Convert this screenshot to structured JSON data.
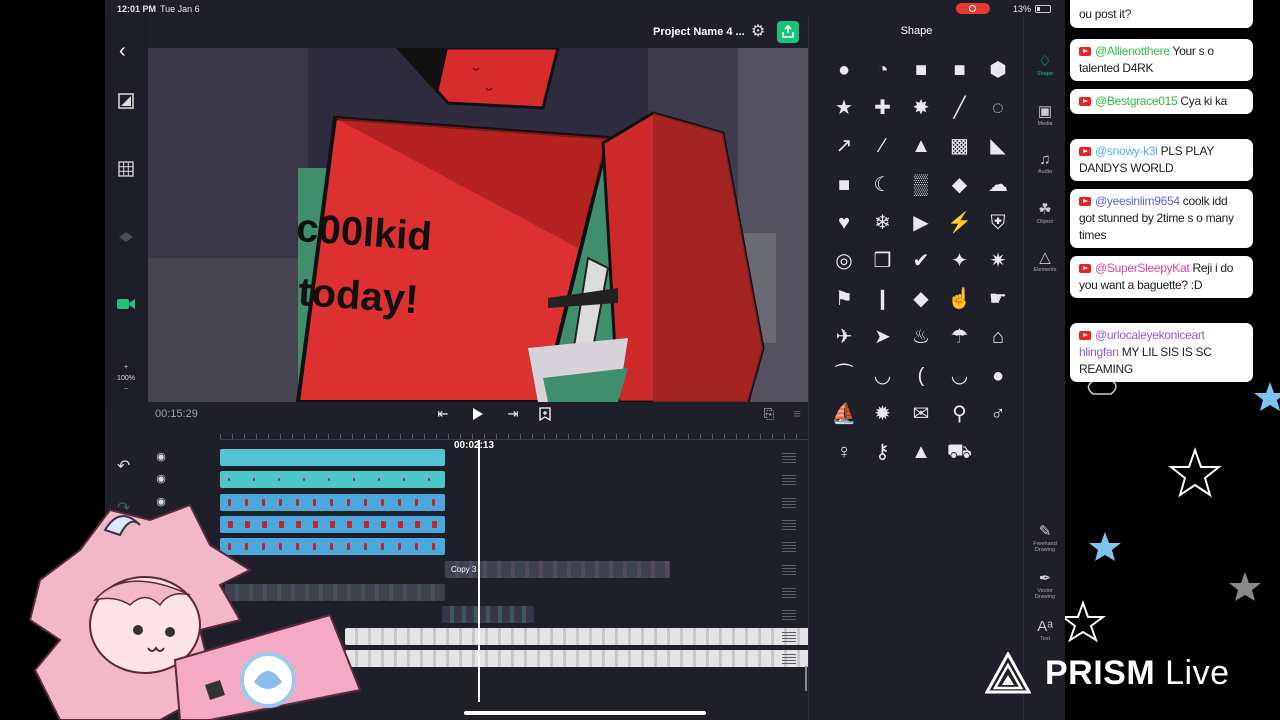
{
  "status": {
    "time": "12:01 PM",
    "date": "Tue Jan 6",
    "battery": "13%"
  },
  "header": {
    "project_name": "Project Name 4 ..."
  },
  "left_tools": {
    "zoom_plus": "+",
    "zoom_level": "100%",
    "zoom_minus": "−"
  },
  "canvas": {
    "caption_line1": "c00lkid",
    "caption_line2": "today!"
  },
  "playback": {
    "timecode": "00:15:29",
    "playhead_time": "00:02:13"
  },
  "timeline": {
    "copy_label": "Copy 3"
  },
  "shape_panel": {
    "title": "Shape",
    "icons": [
      "circle",
      "pie",
      "square",
      "rounded-square",
      "hexagon",
      "star",
      "cross",
      "badge-star",
      "line",
      "arc",
      "arrow",
      "pencil-line",
      "tent",
      "banner",
      "flag-corner",
      "chat-square",
      "moon",
      "stamp",
      "drop",
      "cloud",
      "heart",
      "snowflake",
      "triangle-right",
      "bolt",
      "shield",
      "spiral",
      "puzzle",
      "check",
      "sparkle",
      "pin",
      "flag",
      "bookmark",
      "diamond",
      "thumbs-up",
      "pointing-hand",
      "plane",
      "paper-plane",
      "flame",
      "umbrella",
      "house",
      "mustache",
      "lips",
      "laurel-left",
      "laurel-wreath",
      "apple",
      "sailboat",
      "sun",
      "envelope",
      "magnifier",
      "man",
      "woman",
      "key",
      "rocket",
      "car"
    ]
  },
  "rail": {
    "items": [
      {
        "label": "Shape",
        "icon": "shapes-icon"
      },
      {
        "label": "Media",
        "icon": "media-icon"
      },
      {
        "label": "Audio",
        "icon": "music-note-icon"
      },
      {
        "label": "Object",
        "icon": "object-icon"
      },
      {
        "label": "Elements",
        "icon": "elements-icon"
      }
    ],
    "bottom_items": [
      {
        "label1": "Freehand",
        "label2": "Drawing",
        "icon": "freehand-drawing-icon"
      },
      {
        "label1": "Vector",
        "label2": "Drawing",
        "icon": "vector-drawing-icon"
      },
      {
        "label1": "Text",
        "label2": "",
        "icon": "text-icon"
      }
    ]
  },
  "chat": {
    "messages": [
      {
        "user": "",
        "text": "ou post it?",
        "color": "#222222"
      },
      {
        "user": "@Allienotthere",
        "text": "Your s o talented D4RK",
        "color": "#2bbd4a"
      },
      {
        "user": "@Bestgrace015",
        "text": "Cya ki ka",
        "color": "#2bbd4a"
      },
      {
        "user": "@snowy-k3l",
        "text": "PLS PLAY DANDYS WORLD",
        "color": "#4fb3e8"
      },
      {
        "user": "@yeesinlim9654",
        "text": "coolk idd got stunned by 2time s o many times",
        "color": "#5b62d9"
      },
      {
        "user": "@SuperSleepyKat",
        "text": "Reji i do you want a baguette? :D",
        "color": "#e0409a"
      },
      {
        "user": "@urlocaleyekoniceart hlingfan",
        "text": "MY LIL SIS IS SC REAMING",
        "color": "#8e5bd6"
      }
    ]
  },
  "overlay": {
    "brand": "PRISM",
    "brand_suffix": "Live"
  },
  "colors": {
    "accent": "#19c37d",
    "youtube": "#e22222",
    "rec": "#e53935"
  }
}
